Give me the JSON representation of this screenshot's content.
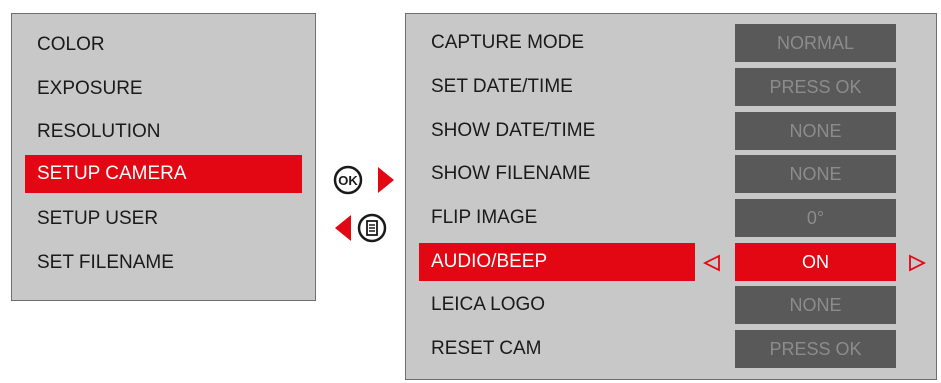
{
  "left_menu": {
    "items": [
      {
        "label": "COLOR"
      },
      {
        "label": "EXPOSURE"
      },
      {
        "label": "RESOLUTION"
      },
      {
        "label": "SETUP CAMERA",
        "selected": true
      },
      {
        "label": "SETUP USER"
      },
      {
        "label": "SET FILENAME"
      }
    ]
  },
  "nav": {
    "ok_label": "OK",
    "ok_icon": "ok-button-icon",
    "forward_arrow_icon": "right-arrow-icon",
    "back_arrow_icon": "left-arrow-icon",
    "menu_icon": "menu-button-icon"
  },
  "right_menu": {
    "items": [
      {
        "label": "CAPTURE MODE",
        "value": "NORMAL"
      },
      {
        "label": "SET DATE/TIME",
        "value": "PRESS OK"
      },
      {
        "label": "SHOW DATE/TIME",
        "value": "NONE"
      },
      {
        "label": "SHOW FILENAME",
        "value": "NONE"
      },
      {
        "label": "FLIP IMAGE",
        "value": "0°"
      },
      {
        "label": "AUDIO/BEEP",
        "value": "ON",
        "selected": true
      },
      {
        "label": "LEICA LOGO",
        "value": "NONE"
      },
      {
        "label": "RESET CAM",
        "value": "PRESS OK"
      }
    ]
  },
  "colors": {
    "accent": "#e30613",
    "panel_bg": "#c8c8c8",
    "value_bg": "#595959",
    "value_text": "#8c8c8c"
  }
}
